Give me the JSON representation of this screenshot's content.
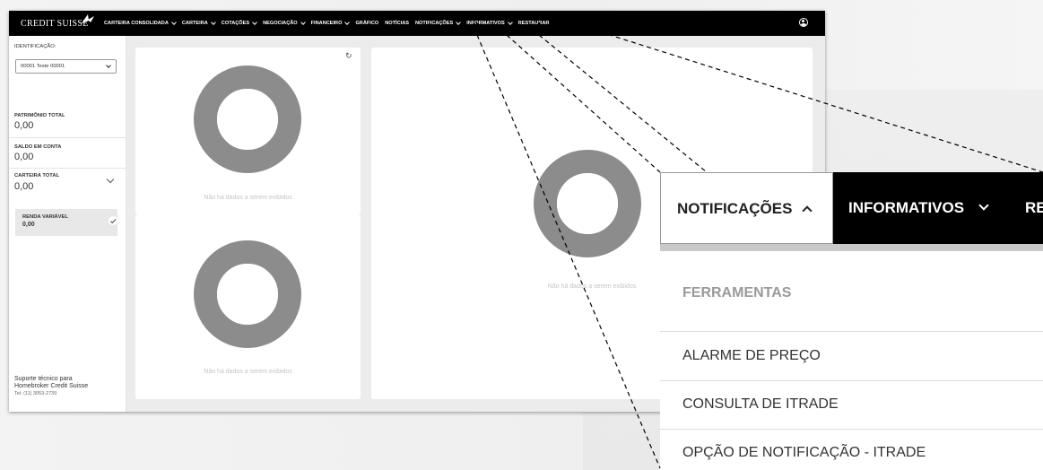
{
  "nav": {
    "logo_text": "CREDIT SUISSE",
    "items": [
      {
        "label": "CARTEIRA CONSOLIDADA",
        "chevron": true
      },
      {
        "label": "CARTEIRA",
        "chevron": true
      },
      {
        "label": "COTAÇÕES",
        "chevron": true
      },
      {
        "label": "NEGOCIAÇÃO",
        "chevron": true
      },
      {
        "label": "FINANCEIRO",
        "chevron": true
      },
      {
        "label": "GRÁFICO",
        "chevron": false
      },
      {
        "label": "NOTÍCIAS",
        "chevron": false
      },
      {
        "label": "NOTIFICAÇÕES",
        "chevron": true
      },
      {
        "label": "INFORMATIVOS",
        "chevron": true
      },
      {
        "label": "RESTAURAR",
        "chevron": false
      }
    ],
    "user_icon": "user-circle-icon"
  },
  "sidebar": {
    "identificacao_label": "IDENTIFICAÇÃO:",
    "account_selected": "00001 Teste 00001",
    "patrimonio_label": "PATRIMÔNIO TOTAL",
    "patrimonio_value": "0,00",
    "saldo_label": "SALDO EM CONTA",
    "saldo_value": "0,00",
    "carteira_label": "CARTEIRA TOTAL",
    "carteira_value": "0,00",
    "renda_label": "RENDA VARIÁVEL",
    "renda_value": "0,00",
    "support_line1": "Suporte técnico para",
    "support_line2": "Homebroker Credit Suisse",
    "support_phone": "Tel: (11) 3053-2739"
  },
  "content": {
    "empty_message": "Não há dados a serem exibidos"
  },
  "zoom_menu": {
    "active_tab": "NOTIFICAÇÕES",
    "next_tab": "INFORMATIVOS",
    "third_tab_partial": "RE",
    "section_title": "FERRAMENTAS",
    "items": [
      "ALARME DE PREÇO",
      "CONSULTA DE ITRADE",
      "OPÇÃO DE NOTIFICAÇÃO - ITRADE"
    ]
  },
  "colors": {
    "nav_bg": "#000000",
    "donut": "#8c8c8c",
    "content_bg": "#ececec"
  }
}
